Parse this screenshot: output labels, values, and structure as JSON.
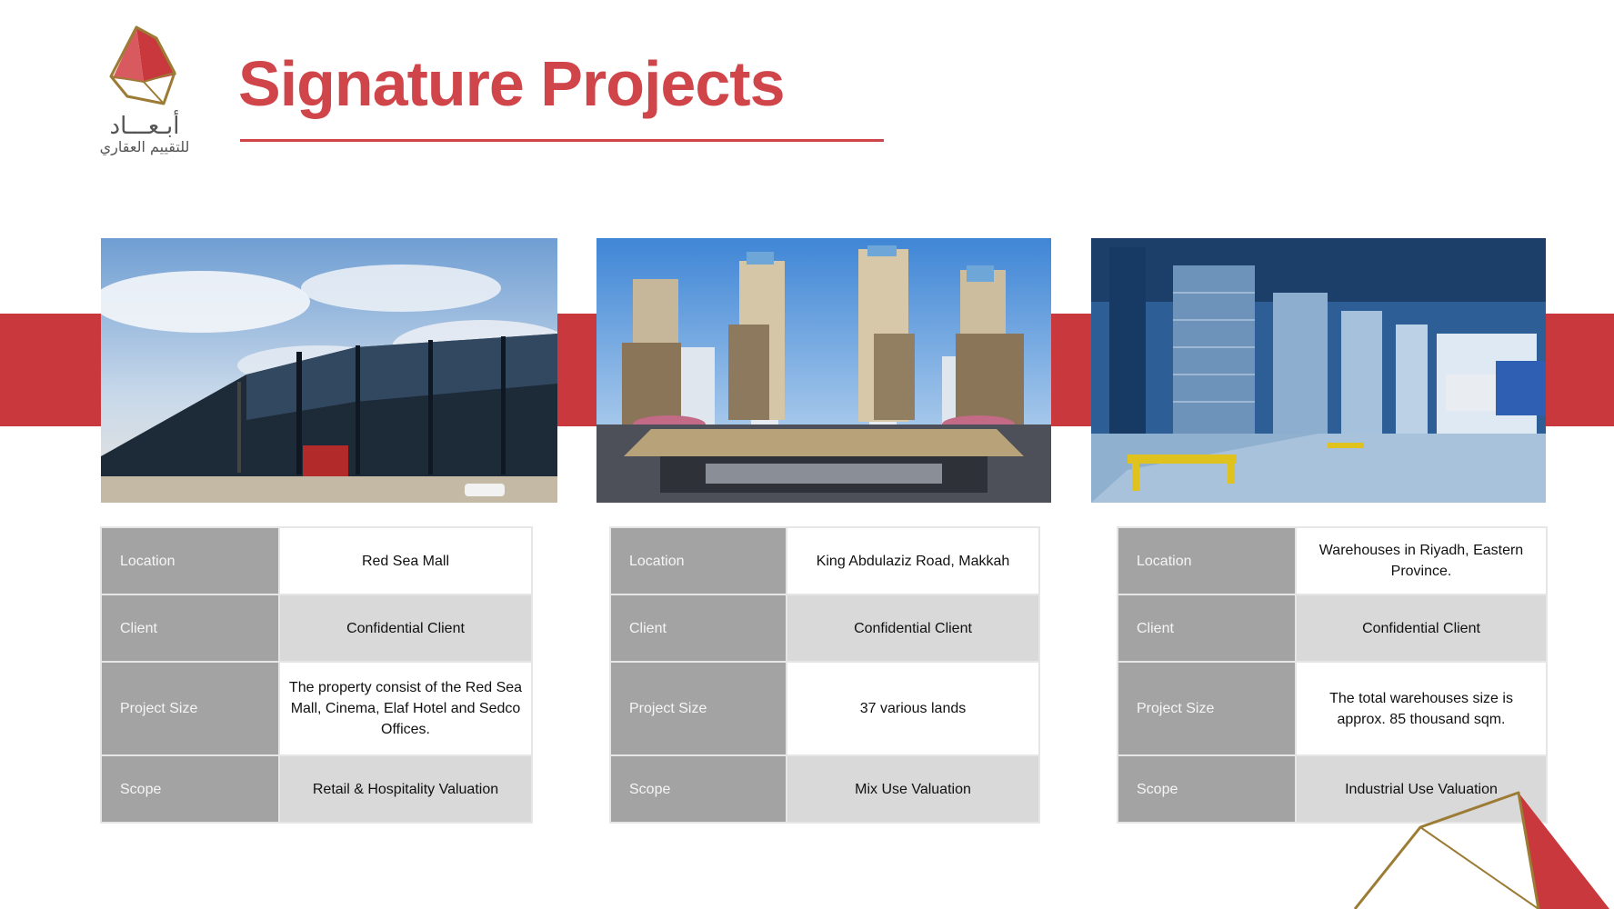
{
  "logo": {
    "arabic_name": "أبـعـــاد",
    "arabic_tagline": "للتقييم العقاري",
    "colors": {
      "red": "#c8383d",
      "gold": "#9c7b35"
    }
  },
  "page": {
    "title": "Signature Projects",
    "accent_color": "#d0454a"
  },
  "projects": [
    {
      "image_icon": "shopping-mall-photo",
      "rows": [
        {
          "label": "Location",
          "value": "Red Sea Mall"
        },
        {
          "label": "Client",
          "value": "Confidential Client"
        },
        {
          "label": "Project Size",
          "value": "The property consist of the Red Sea Mall,  Cinema, Elaf  Hotel and Sedco Offices."
        },
        {
          "label": "Scope",
          "value": "Retail & Hospitality Valuation"
        }
      ]
    },
    {
      "image_icon": "mixed-use-towers-photo",
      "rows": [
        {
          "label": "Location",
          "value": "King Abdulaziz Road, Makkah"
        },
        {
          "label": "Client",
          "value": "Confidential Client"
        },
        {
          "label": "Project Size",
          "value": "37 various lands"
        },
        {
          "label": "Scope",
          "value": "Mix Use Valuation"
        }
      ]
    },
    {
      "image_icon": "warehouse-interior-photo",
      "rows": [
        {
          "label": "Location",
          "value": "Warehouses in Riyadh, Eastern Province."
        },
        {
          "label": "Client",
          "value": "Confidential Client"
        },
        {
          "label": "Project Size",
          "value": "The total warehouses size is approx. 85 thousand sqm."
        },
        {
          "label": "Scope",
          "value": "Industrial Use Valuation"
        }
      ]
    }
  ]
}
